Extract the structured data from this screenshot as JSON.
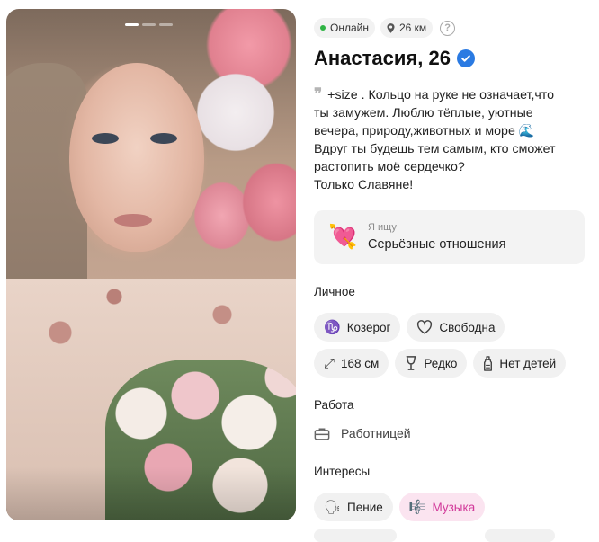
{
  "photo": {
    "pages": 3,
    "active_page": 1
  },
  "status": {
    "online": "Онлайн",
    "distance": "26 км",
    "help": "?"
  },
  "profile": {
    "name_age": "Анастасия, 26",
    "bio": "+size . Кольцо на руке не означает,что\nты замужем. Люблю тёплые, уютные\nвечера, природу,животных и море 🌊\nВдруг ты будешь тем самым, кто сможет\nрастопить моё сердечко?\nТолько Славяне!"
  },
  "seeking": {
    "label": "Я ищу",
    "value": "Серьёзные отношения"
  },
  "personal": {
    "title": "Личное",
    "zodiac": "Козерог",
    "relationship": "Свободна",
    "height": "168 см",
    "drinking": "Редко",
    "children": "Нет детей"
  },
  "work": {
    "title": "Работа",
    "value": "Работницей"
  },
  "interests": {
    "title": "Интересы",
    "items": [
      "Пение",
      "Музыка"
    ]
  },
  "colors": {
    "online": "#2fb344",
    "verified": "#2a7ae2",
    "interest_highlight": "#d23a9a"
  }
}
